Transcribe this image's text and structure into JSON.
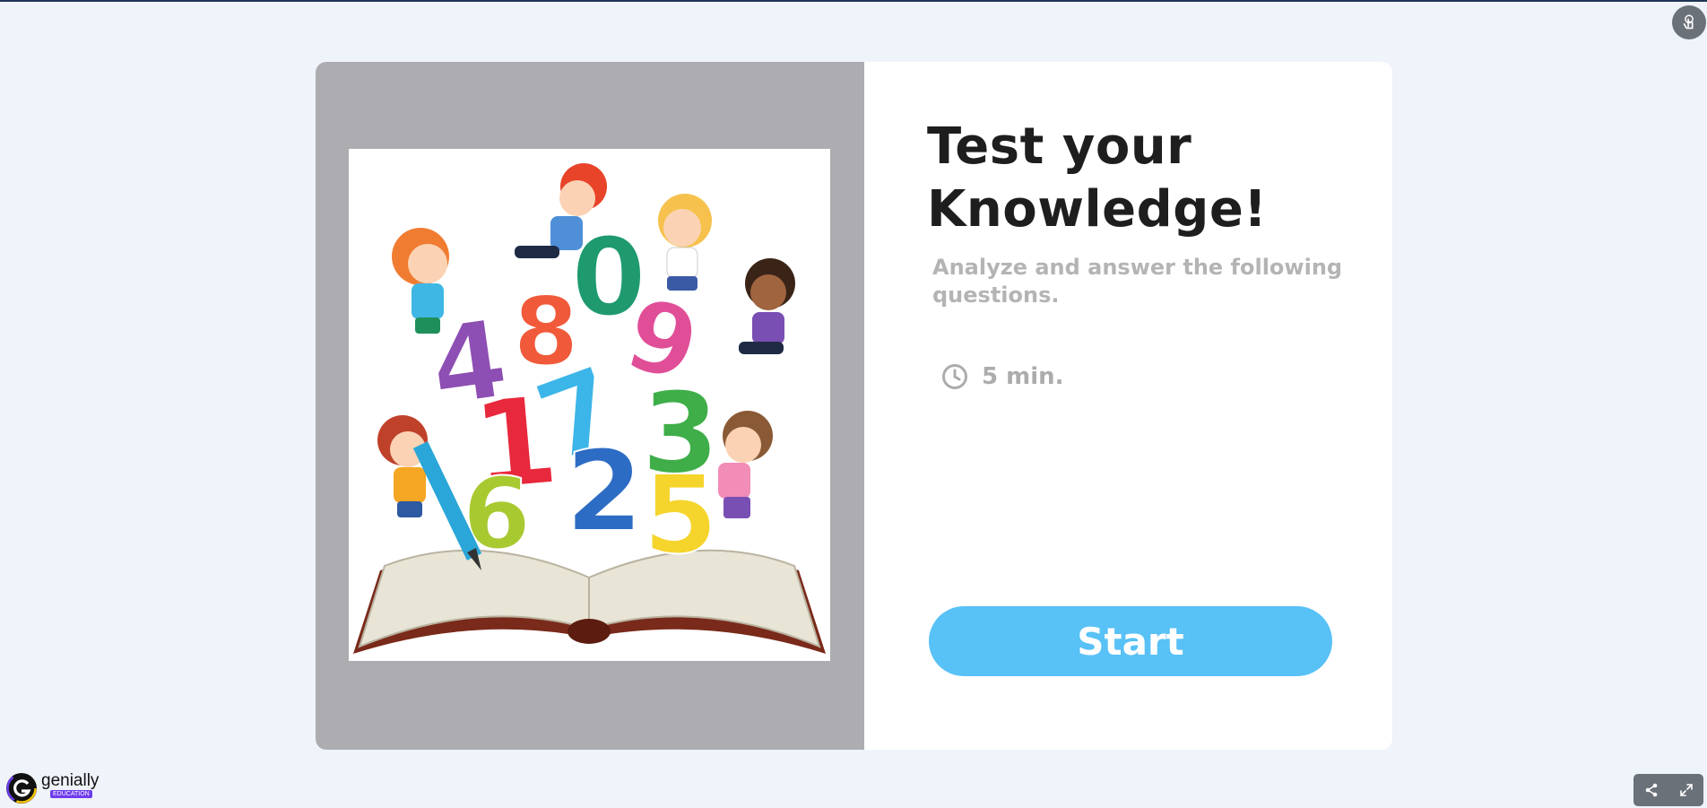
{
  "quiz": {
    "title_line1": "Test your",
    "title_line2": "Knowledge!",
    "subtitle": "Analyze and answer the following questions.",
    "duration": "5 min.",
    "start_label": "Start"
  },
  "illustration": {
    "digits": [
      "4",
      "8",
      "0",
      "9",
      "1",
      "7",
      "3",
      "6",
      "2",
      "5"
    ]
  },
  "brand": {
    "name": "genially",
    "badge": "EDUCATION"
  },
  "icons": [
    "touch-icon",
    "clock-icon",
    "share-icon",
    "fullscreen-icon",
    "genially-logo-icon"
  ],
  "colors": {
    "background": "#eff3fa",
    "image_panel": "#adadb1",
    "card": "#ffffff",
    "title": "#1e1e1e",
    "subtitle": "#b4b4b4",
    "start_button": "#58c1f6",
    "badge": "#6e3dee",
    "tool_bar": "#6b7179"
  }
}
